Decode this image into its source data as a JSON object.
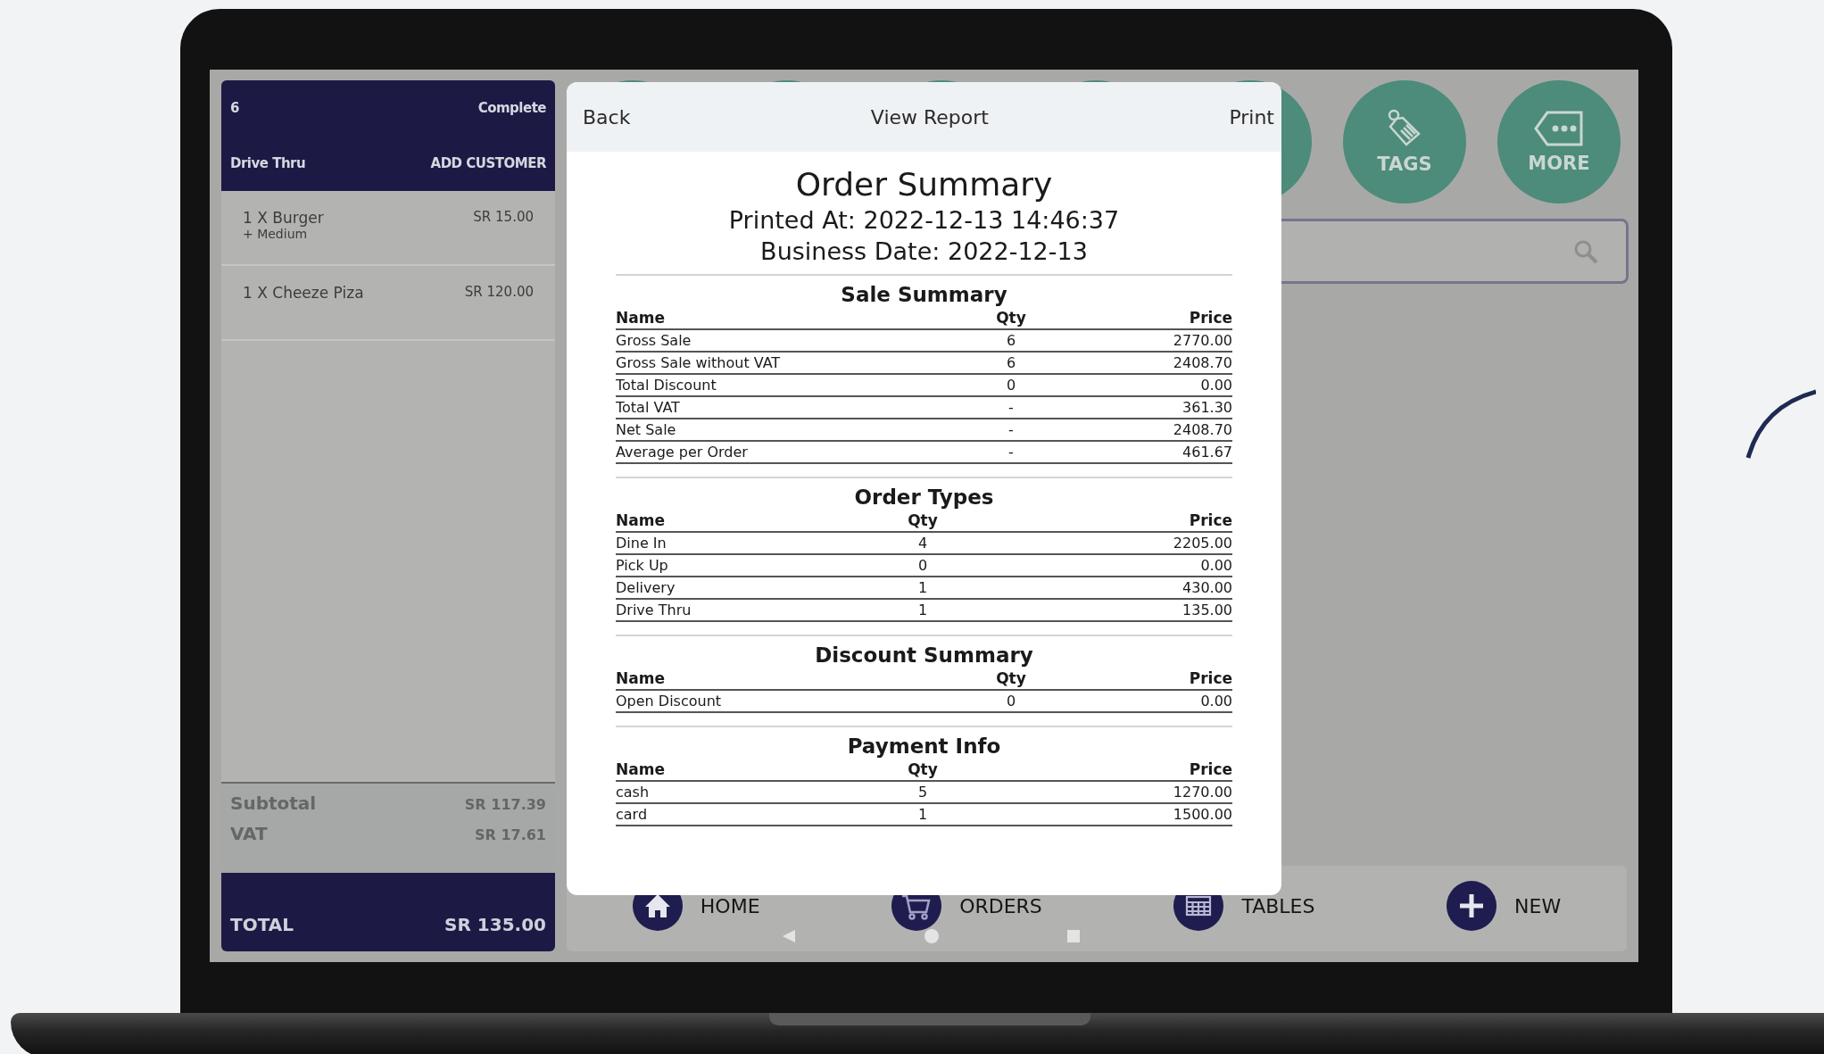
{
  "order_panel": {
    "order_number": "6",
    "status": "Complete",
    "order_type": "Drive Thru",
    "add_customer": "ADD CUSTOMER",
    "items": [
      {
        "name": "1 X Burger",
        "modifier": "+ Medium",
        "price": "SR 15.00"
      },
      {
        "name": "1 X Cheeze Piza",
        "price": "SR 120.00"
      }
    ],
    "subtotal": {
      "label": "Subtotal",
      "value": "SR 117.39"
    },
    "vat": {
      "label": "VAT",
      "value": "SR 17.61"
    },
    "total": {
      "label": "TOTAL",
      "value": "SR 135.00"
    }
  },
  "top_buttons": [
    {
      "label": "TAGS",
      "kind": "tag"
    },
    {
      "label": "MORE",
      "kind": "more"
    }
  ],
  "report": {
    "back": "Back",
    "title": "View Report",
    "print": "Print",
    "heading": "Order Summary",
    "printed_at": "Printed At: 2022-12-13 14:46:37",
    "business_date": "Business Date: 2022-12-13",
    "sections": [
      {
        "title": "Sale Summary",
        "columns": [
          "Name",
          "Qty",
          "Price"
        ],
        "rows": [
          [
            "Gross Sale",
            "6",
            "2770.00"
          ],
          [
            "Gross Sale without VAT",
            "6",
            "2408.70"
          ],
          [
            "Total Discount",
            "0",
            "0.00"
          ],
          [
            "Total VAT",
            "-",
            "361.30"
          ],
          [
            "Net Sale",
            "-",
            "2408.70"
          ],
          [
            "Average per Order",
            "-",
            "461.67"
          ]
        ]
      },
      {
        "title": "Order Types",
        "columns": [
          "Name",
          "Qty",
          "Price"
        ],
        "rows": [
          [
            "Dine In",
            "4",
            "2205.00"
          ],
          [
            "Pick Up",
            "0",
            "0.00"
          ],
          [
            "Delivery",
            "1",
            "430.00"
          ],
          [
            "Drive Thru",
            "1",
            "135.00"
          ]
        ]
      },
      {
        "title": "Discount Summary",
        "columns": [
          "Name",
          "Qty",
          "Price"
        ],
        "rows": [
          [
            "Open Discount",
            "0",
            "0.00"
          ]
        ]
      },
      {
        "title": "Payment Info",
        "columns": [
          "Name",
          "Qty",
          "Price"
        ],
        "rows": [
          [
            "cash",
            "5",
            "1270.00"
          ],
          [
            "card",
            "1",
            "1500.00"
          ]
        ]
      }
    ]
  },
  "bottom_nav": [
    {
      "label": "HOME",
      "kind": "home"
    },
    {
      "label": "ORDERS",
      "kind": "orders"
    },
    {
      "label": "TABLES",
      "kind": "tables"
    },
    {
      "label": "NEW",
      "kind": "new"
    }
  ]
}
